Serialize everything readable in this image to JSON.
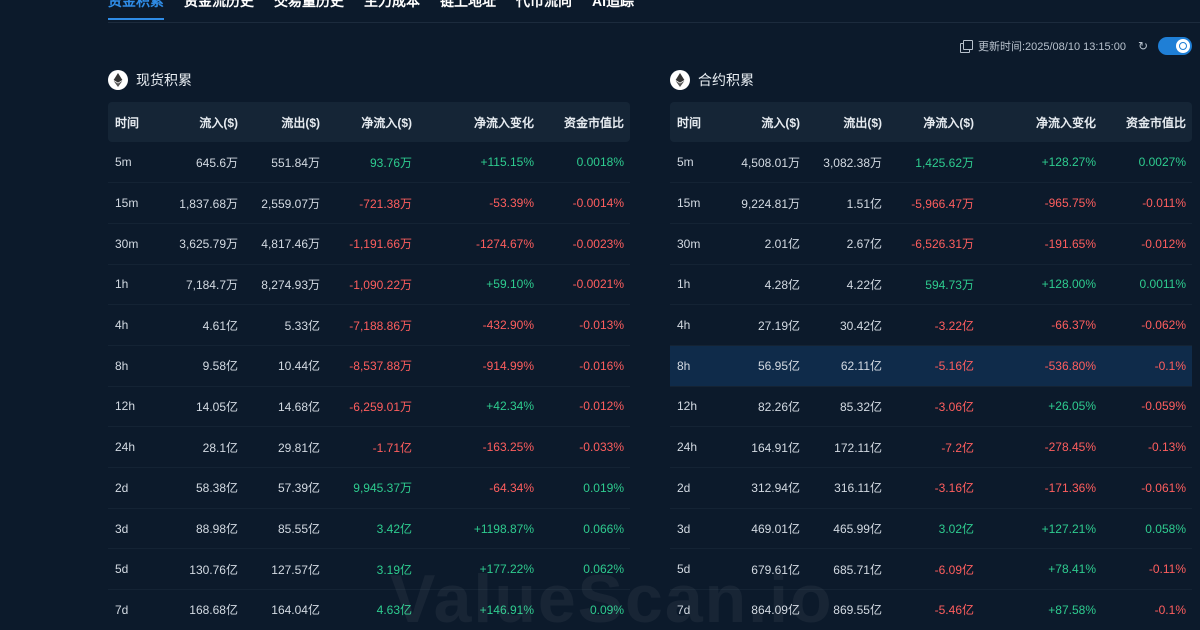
{
  "tabs": [
    "资金积累",
    "资金流历史",
    "交易量历史",
    "主力成本",
    "链上地址",
    "代币流向",
    "AI追踪"
  ],
  "active_tab": 0,
  "update_time": "更新时间:2025/08/10 13:15:00",
  "colors": {
    "positive": "#2ecc8f",
    "negative": "#ff5e5e",
    "accent": "#2f8ce6",
    "background": "#0c1a2b"
  },
  "icons": {
    "copy": "copy-icon",
    "refresh": "refresh-icon",
    "toggle": "toggle-switch",
    "coin": "eth-icon"
  },
  "headers": [
    "时间",
    "流入($)",
    "流出($)",
    "净流入($)",
    "净流入变化",
    "资金市值比"
  ],
  "spot": {
    "title": "现货积累",
    "rows": [
      [
        "5m",
        "645.6万",
        "551.84万",
        "93.76万",
        "+115.15%",
        "0.0018%"
      ],
      [
        "15m",
        "1,837.68万",
        "2,559.07万",
        "-721.38万",
        "-53.39%",
        "-0.0014%"
      ],
      [
        "30m",
        "3,625.79万",
        "4,817.46万",
        "-1,191.66万",
        "-1274.67%",
        "-0.0023%"
      ],
      [
        "1h",
        "7,184.7万",
        "8,274.93万",
        "-1,090.22万",
        "+59.10%",
        "-0.0021%"
      ],
      [
        "4h",
        "4.61亿",
        "5.33亿",
        "-7,188.86万",
        "-432.90%",
        "-0.013%"
      ],
      [
        "8h",
        "9.58亿",
        "10.44亿",
        "-8,537.88万",
        "-914.99%",
        "-0.016%"
      ],
      [
        "12h",
        "14.05亿",
        "14.68亿",
        "-6,259.01万",
        "+42.34%",
        "-0.012%"
      ],
      [
        "24h",
        "28.1亿",
        "29.81亿",
        "-1.71亿",
        "-163.25%",
        "-0.033%"
      ],
      [
        "2d",
        "58.38亿",
        "57.39亿",
        "9,945.37万",
        "-64.34%",
        "0.019%"
      ],
      [
        "3d",
        "88.98亿",
        "85.55亿",
        "3.42亿",
        "+1198.87%",
        "0.066%"
      ],
      [
        "5d",
        "130.76亿",
        "127.57亿",
        "3.19亿",
        "+177.22%",
        "0.062%"
      ],
      [
        "7d",
        "168.68亿",
        "164.04亿",
        "4.63亿",
        "+146.91%",
        "0.09%"
      ]
    ]
  },
  "futures": {
    "title": "合约积累",
    "highlight_row": 5,
    "rows": [
      [
        "5m",
        "4,508.01万",
        "3,082.38万",
        "1,425.62万",
        "+128.27%",
        "0.0027%"
      ],
      [
        "15m",
        "9,224.81万",
        "1.51亿",
        "-5,966.47万",
        "-965.75%",
        "-0.011%"
      ],
      [
        "30m",
        "2.01亿",
        "2.67亿",
        "-6,526.31万",
        "-191.65%",
        "-0.012%"
      ],
      [
        "1h",
        "4.28亿",
        "4.22亿",
        "594.73万",
        "+128.00%",
        "0.0011%"
      ],
      [
        "4h",
        "27.19亿",
        "30.42亿",
        "-3.22亿",
        "-66.37%",
        "-0.062%"
      ],
      [
        "8h",
        "56.95亿",
        "62.11亿",
        "-5.16亿",
        "-536.80%",
        "-0.1%"
      ],
      [
        "12h",
        "82.26亿",
        "85.32亿",
        "-3.06亿",
        "+26.05%",
        "-0.059%"
      ],
      [
        "24h",
        "164.91亿",
        "172.11亿",
        "-7.2亿",
        "-278.45%",
        "-0.13%"
      ],
      [
        "2d",
        "312.94亿",
        "316.11亿",
        "-3.16亿",
        "-171.36%",
        "-0.061%"
      ],
      [
        "3d",
        "469.01亿",
        "465.99亿",
        "3.02亿",
        "+127.21%",
        "0.058%"
      ],
      [
        "5d",
        "679.61亿",
        "685.71亿",
        "-6.09亿",
        "+78.41%",
        "-0.11%"
      ],
      [
        "7d",
        "864.09亿",
        "869.55亿",
        "-5.46亿",
        "+87.58%",
        "-0.1%"
      ]
    ]
  },
  "watermark": "ValueScan.io"
}
